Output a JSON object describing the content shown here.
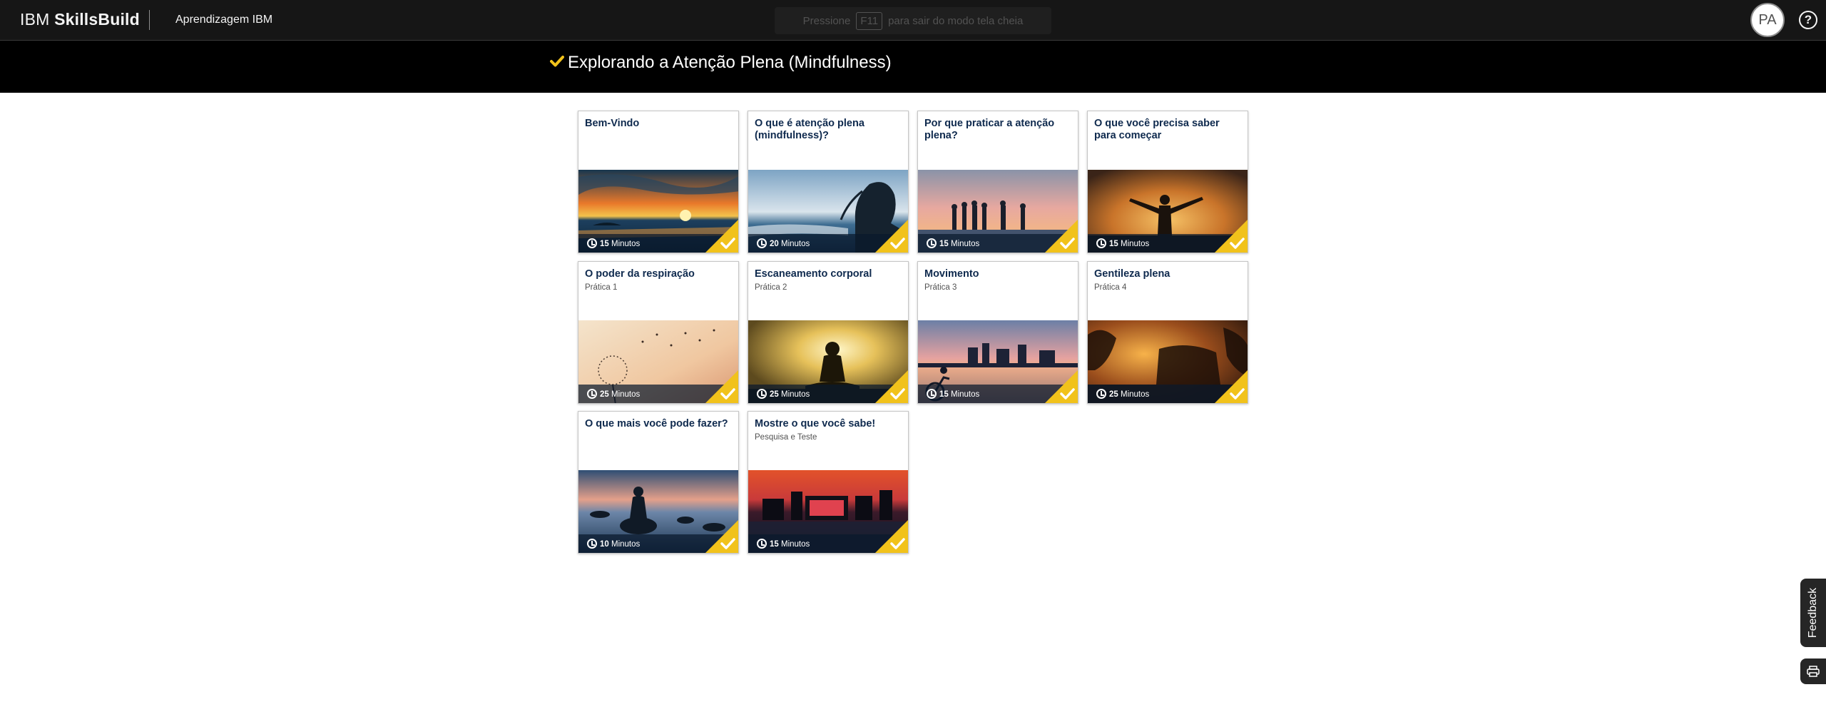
{
  "header": {
    "brand_light": "IBM",
    "brand_bold": "SkillsBuild",
    "nav_link": "Aprendizagem IBM",
    "fullscreen_hint": {
      "before": "Pressione",
      "key": "F11",
      "after": "para sair do modo tela cheia"
    },
    "avatar_initials": "PA",
    "help_glyph": "?"
  },
  "course": {
    "title": "Explorando a Atenção Plena (Mindfulness)",
    "status_icon": "checkmark-icon",
    "accent_color": "#f1c21b"
  },
  "cards": [
    {
      "title": "Bem-Vindo",
      "subtitle": "",
      "duration_value": "15",
      "duration_unit": "Minutos",
      "completed": true,
      "image": "ocean-sunset"
    },
    {
      "title": "O que é atenção plena (mindfulness)?",
      "subtitle": "",
      "duration_value": "20",
      "duration_unit": "Minutos",
      "completed": true,
      "image": "woman-silhouette-sea"
    },
    {
      "title": "Por que praticar a atenção plena?",
      "subtitle": "",
      "duration_value": "15",
      "duration_unit": "Minutos",
      "completed": true,
      "image": "group-beach-sunset"
    },
    {
      "title": "O que você precisa saber para começar",
      "subtitle": "",
      "duration_value": "15",
      "duration_unit": "Minutos",
      "completed": true,
      "image": "person-arms-open-sunset"
    },
    {
      "title": "O poder da respiração",
      "subtitle": "Prática 1",
      "duration_value": "25",
      "duration_unit": "Minutos",
      "completed": true,
      "image": "dandelion-sunset"
    },
    {
      "title": "Escaneamento corporal",
      "subtitle": "Prática 2",
      "duration_value": "25",
      "duration_unit": "Minutos",
      "completed": true,
      "image": "meditating-silhouette"
    },
    {
      "title": "Movimento",
      "subtitle": "Prática 3",
      "duration_value": "15",
      "duration_unit": "Minutos",
      "completed": true,
      "image": "cyclist-waterfront"
    },
    {
      "title": "Gentileza plena",
      "subtitle": "Prática 4",
      "duration_value": "25",
      "duration_unit": "Minutos",
      "completed": true,
      "image": "trees-golden-light"
    },
    {
      "title": "O que mais você pode fazer?",
      "subtitle": "",
      "duration_value": "10",
      "duration_unit": "Minutos",
      "completed": true,
      "image": "person-on-rock-lake"
    },
    {
      "title": "Mostre o que você sabe!",
      "subtitle": "Pesquisa e Teste",
      "duration_value": "15",
      "duration_unit": "Minutos",
      "completed": true,
      "image": "city-reflection-sunset"
    }
  ],
  "side": {
    "feedback_label": "Feedback",
    "print_icon": "print-icon"
  }
}
